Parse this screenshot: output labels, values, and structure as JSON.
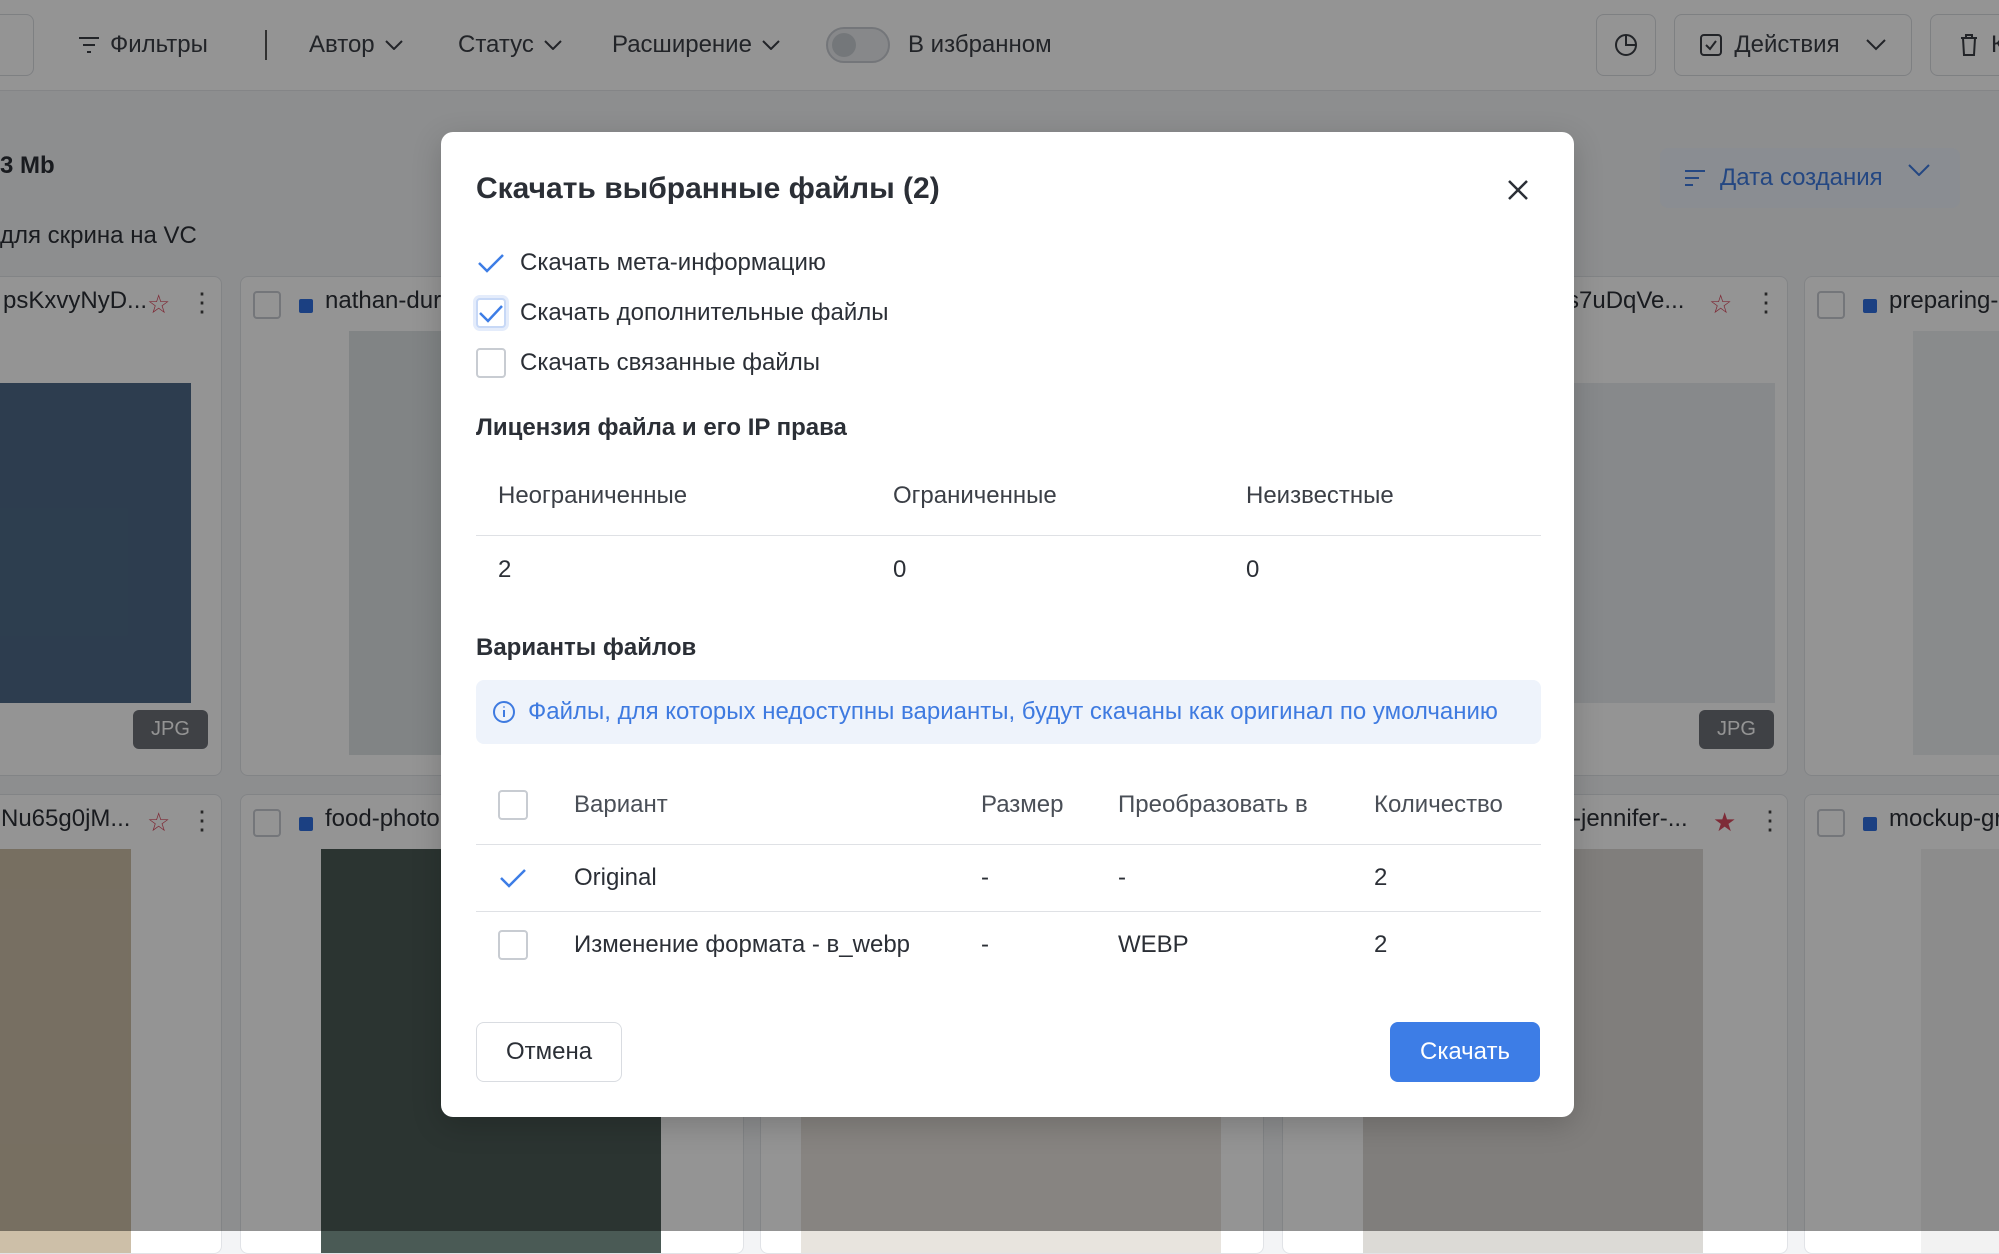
{
  "toolbar": {
    "filters_label": "Фильтры",
    "author_label": "Автор",
    "status_label": "Статус",
    "extension_label": "Расширение",
    "favorites_label": "В избранном",
    "actions_label": "Действия",
    "trash_partial_label": "К"
  },
  "summary": {
    "size_text": "3 Mb",
    "collection_title": "для скрина на VC"
  },
  "sort": {
    "label": "Дата создания"
  },
  "cards": [
    {
      "name": "psKxvyNyD...",
      "badge": "JPG",
      "starred": false
    },
    {
      "name": "nathan-dur",
      "badge": "",
      "starred": false
    },
    {
      "name": "s7uDqVe...",
      "badge": "JPG",
      "starred": false
    },
    {
      "name": "preparing-",
      "badge": "",
      "starred": false
    },
    {
      "name": "Nu65g0jM...",
      "badge": "",
      "starred": false
    },
    {
      "name": "food-photo",
      "badge": "",
      "starred": false
    },
    {
      "name": "-jennifer-...",
      "badge": "",
      "starred": true
    },
    {
      "name": "mockup-gr",
      "badge": "",
      "starred": false
    }
  ],
  "modal": {
    "title": "Скачать выбранные файлы (2)",
    "options": [
      {
        "label": "Скачать мета-информацию",
        "checked": true
      },
      {
        "label": "Скачать дополнительные файлы",
        "checked": true
      },
      {
        "label": "Скачать связанные файлы",
        "checked": false
      }
    ],
    "license_section": "Лицензия файла и его IP права",
    "license_headers": [
      "Неограниченные",
      "Ограниченные",
      "Неизвестные"
    ],
    "license_values": [
      "2",
      "0",
      "0"
    ],
    "variants_section": "Варианты файлов",
    "variants_note": "Файлы, для которых недоступны варианты, будут скачаны как оригинал по умолчанию",
    "variant_headers": [
      "Вариант",
      "Размер",
      "Преобразовать в",
      "Количество"
    ],
    "variant_rows": [
      {
        "variant": "Original",
        "size": "-",
        "convert": "-",
        "count": "2",
        "checked": true
      },
      {
        "variant": "Изменение формата - в_webp",
        "size": "-",
        "convert": "WEBP",
        "count": "2",
        "checked": false
      }
    ],
    "cancel_label": "Отмена",
    "download_label": "Скачать"
  },
  "colors": {
    "accent": "#3d7de6",
    "overlay": "rgba(0,0,0,0.42)"
  }
}
